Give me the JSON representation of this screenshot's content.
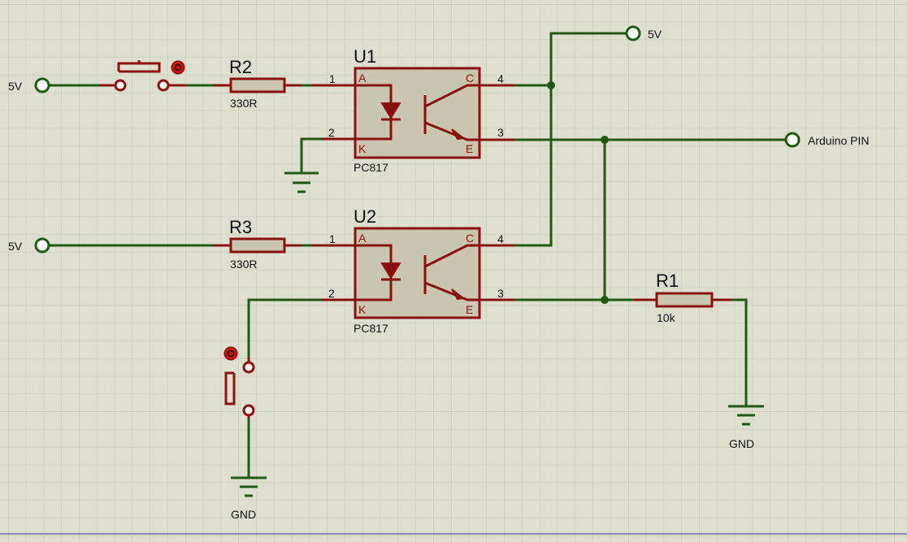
{
  "terminals": {
    "in_top": "5V",
    "in_mid": "5V",
    "supply_top": "5V",
    "output": "Arduino PIN",
    "gnd_r1": "GND",
    "gnd_sw2": "GND"
  },
  "R2": {
    "ref": "R2",
    "value": "330R"
  },
  "R3": {
    "ref": "R3",
    "value": "330R"
  },
  "R1": {
    "ref": "R1",
    "value": "10k"
  },
  "U1": {
    "ref": "U1",
    "part": "PC817",
    "pins": {
      "p1": "1",
      "p2": "2",
      "p3": "3",
      "p4": "4",
      "A": "A",
      "K": "K",
      "C": "C",
      "E": "E"
    }
  },
  "U2": {
    "ref": "U2",
    "part": "PC817",
    "pins": {
      "p1": "1",
      "p2": "2",
      "p3": "3",
      "p4": "4",
      "A": "A",
      "K": "K",
      "C": "C",
      "E": "E"
    }
  },
  "colors": {
    "wire": "#1f5a14",
    "component": "#8b1010",
    "background": "#dfdfd0",
    "grid": "#c6c6b4"
  }
}
